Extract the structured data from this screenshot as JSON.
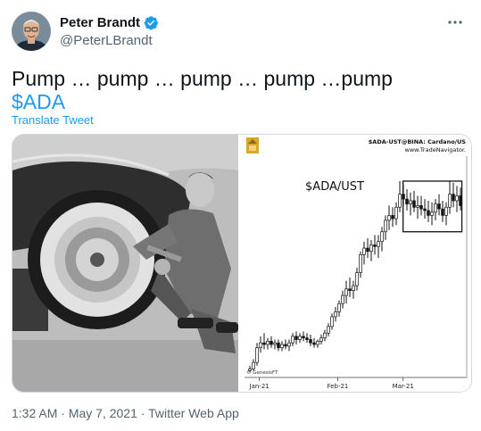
{
  "author": {
    "name": "Peter Brandt",
    "handle": "@PeterLBrandt",
    "verified": true,
    "verified_color": "#1d9bf0"
  },
  "more_icon": "more-horizontal-icon",
  "tweet": {
    "text_line1": "Pump … pump … pump … pump …pump",
    "cashtag": "$ADA",
    "translate_label": "Translate Tweet"
  },
  "media": {
    "photo_description_icon": "photo-man-pumping-tire",
    "chart_header_left": "$ADA-UST@BINA: Cardano/US",
    "chart_header_right": "www.TradeNavigator.",
    "chart_watermark": "© GenesisFT"
  },
  "footer": {
    "time": "1:32 AM",
    "separator": " · ",
    "date": "May 7, 2021",
    "separator2": " · ",
    "source": "Twitter Web App"
  },
  "chart_data": {
    "type": "candlestick",
    "title": "$ADA/UST",
    "xlabel": "",
    "ylabel": "",
    "x_ticks": [
      "Jan-21",
      "Feb-21",
      "Mar-21"
    ],
    "x_tick_positions": [
      0.06,
      0.42,
      0.72
    ],
    "ylim": [
      0.15,
      1.45
    ],
    "grid": false,
    "annotation": "consolidation box",
    "box_range": {
      "x": [
        0.72,
        0.99
      ],
      "y": [
        1.02,
        1.33
      ]
    },
    "series": [
      {
        "values": [
          [
            0.17,
            0.2,
            0.16,
            0.18
          ],
          [
            0.18,
            0.24,
            0.17,
            0.22
          ],
          [
            0.22,
            0.34,
            0.2,
            0.31
          ],
          [
            0.31,
            0.38,
            0.28,
            0.34
          ],
          [
            0.34,
            0.4,
            0.3,
            0.33
          ],
          [
            0.33,
            0.37,
            0.3,
            0.35
          ],
          [
            0.35,
            0.38,
            0.31,
            0.33
          ],
          [
            0.33,
            0.36,
            0.3,
            0.34
          ],
          [
            0.34,
            0.36,
            0.29,
            0.31
          ],
          [
            0.31,
            0.35,
            0.29,
            0.33
          ],
          [
            0.33,
            0.36,
            0.3,
            0.32
          ],
          [
            0.32,
            0.36,
            0.29,
            0.34
          ],
          [
            0.34,
            0.4,
            0.32,
            0.38
          ],
          [
            0.38,
            0.41,
            0.33,
            0.36
          ],
          [
            0.36,
            0.4,
            0.34,
            0.38
          ],
          [
            0.38,
            0.41,
            0.35,
            0.37
          ],
          [
            0.37,
            0.4,
            0.34,
            0.36
          ],
          [
            0.36,
            0.39,
            0.32,
            0.34
          ],
          [
            0.34,
            0.37,
            0.31,
            0.33
          ],
          [
            0.33,
            0.36,
            0.31,
            0.35
          ],
          [
            0.35,
            0.39,
            0.33,
            0.37
          ],
          [
            0.37,
            0.42,
            0.35,
            0.4
          ],
          [
            0.4,
            0.46,
            0.38,
            0.44
          ],
          [
            0.44,
            0.52,
            0.42,
            0.5
          ],
          [
            0.5,
            0.56,
            0.47,
            0.53
          ],
          [
            0.53,
            0.6,
            0.5,
            0.58
          ],
          [
            0.58,
            0.66,
            0.55,
            0.63
          ],
          [
            0.63,
            0.72,
            0.58,
            0.67
          ],
          [
            0.67,
            0.74,
            0.62,
            0.66
          ],
          [
            0.66,
            0.72,
            0.61,
            0.69
          ],
          [
            0.69,
            0.8,
            0.66,
            0.77
          ],
          [
            0.77,
            0.9,
            0.74,
            0.88
          ],
          [
            0.88,
            0.96,
            0.82,
            0.92
          ],
          [
            0.92,
            0.98,
            0.86,
            0.9
          ],
          [
            0.9,
            0.97,
            0.84,
            0.94
          ],
          [
            0.94,
            1.0,
            0.88,
            0.93
          ],
          [
            0.93,
            1.0,
            0.86,
            0.96
          ],
          [
            0.96,
            1.05,
            0.9,
            1.02
          ],
          [
            1.02,
            1.12,
            0.97,
            1.09
          ],
          [
            1.09,
            1.18,
            1.03,
            1.12
          ],
          [
            1.12,
            1.17,
            1.05,
            1.1
          ],
          [
            1.1,
            1.2,
            1.06,
            1.17
          ],
          [
            1.17,
            1.33,
            1.14,
            1.25
          ],
          [
            1.25,
            1.31,
            1.18,
            1.22
          ],
          [
            1.22,
            1.28,
            1.15,
            1.19
          ],
          [
            1.19,
            1.26,
            1.12,
            1.21
          ],
          [
            1.21,
            1.27,
            1.14,
            1.17
          ],
          [
            1.17,
            1.24,
            1.1,
            1.18
          ],
          [
            1.18,
            1.24,
            1.12,
            1.16
          ],
          [
            1.16,
            1.22,
            1.1,
            1.15
          ],
          [
            1.15,
            1.21,
            1.08,
            1.12
          ],
          [
            1.12,
            1.2,
            1.06,
            1.14
          ],
          [
            1.14,
            1.22,
            1.09,
            1.19
          ],
          [
            1.19,
            1.25,
            1.12,
            1.16
          ],
          [
            1.16,
            1.21,
            1.08,
            1.12
          ],
          [
            1.12,
            1.2,
            1.06,
            1.17
          ],
          [
            1.17,
            1.33,
            1.13,
            1.25
          ],
          [
            1.25,
            1.32,
            1.17,
            1.21
          ],
          [
            1.21,
            1.3,
            1.14,
            1.24
          ],
          [
            1.24,
            1.29,
            1.15,
            1.18
          ]
        ]
      }
    ]
  }
}
